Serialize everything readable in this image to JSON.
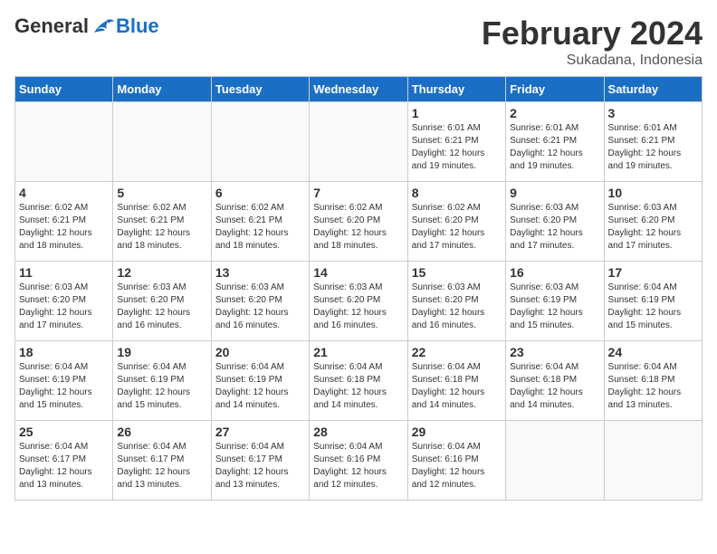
{
  "header": {
    "logo": {
      "general": "General",
      "blue": "Blue",
      "tagline": ""
    },
    "title": "February 2024",
    "subtitle": "Sukadana, Indonesia"
  },
  "weekdays": [
    "Sunday",
    "Monday",
    "Tuesday",
    "Wednesday",
    "Thursday",
    "Friday",
    "Saturday"
  ],
  "weeks": [
    [
      {
        "day": "",
        "info": ""
      },
      {
        "day": "",
        "info": ""
      },
      {
        "day": "",
        "info": ""
      },
      {
        "day": "",
        "info": ""
      },
      {
        "day": "1",
        "info": "Sunrise: 6:01 AM\nSunset: 6:21 PM\nDaylight: 12 hours\nand 19 minutes."
      },
      {
        "day": "2",
        "info": "Sunrise: 6:01 AM\nSunset: 6:21 PM\nDaylight: 12 hours\nand 19 minutes."
      },
      {
        "day": "3",
        "info": "Sunrise: 6:01 AM\nSunset: 6:21 PM\nDaylight: 12 hours\nand 19 minutes."
      }
    ],
    [
      {
        "day": "4",
        "info": "Sunrise: 6:02 AM\nSunset: 6:21 PM\nDaylight: 12 hours\nand 18 minutes."
      },
      {
        "day": "5",
        "info": "Sunrise: 6:02 AM\nSunset: 6:21 PM\nDaylight: 12 hours\nand 18 minutes."
      },
      {
        "day": "6",
        "info": "Sunrise: 6:02 AM\nSunset: 6:21 PM\nDaylight: 12 hours\nand 18 minutes."
      },
      {
        "day": "7",
        "info": "Sunrise: 6:02 AM\nSunset: 6:20 PM\nDaylight: 12 hours\nand 18 minutes."
      },
      {
        "day": "8",
        "info": "Sunrise: 6:02 AM\nSunset: 6:20 PM\nDaylight: 12 hours\nand 17 minutes."
      },
      {
        "day": "9",
        "info": "Sunrise: 6:03 AM\nSunset: 6:20 PM\nDaylight: 12 hours\nand 17 minutes."
      },
      {
        "day": "10",
        "info": "Sunrise: 6:03 AM\nSunset: 6:20 PM\nDaylight: 12 hours\nand 17 minutes."
      }
    ],
    [
      {
        "day": "11",
        "info": "Sunrise: 6:03 AM\nSunset: 6:20 PM\nDaylight: 12 hours\nand 17 minutes."
      },
      {
        "day": "12",
        "info": "Sunrise: 6:03 AM\nSunset: 6:20 PM\nDaylight: 12 hours\nand 16 minutes."
      },
      {
        "day": "13",
        "info": "Sunrise: 6:03 AM\nSunset: 6:20 PM\nDaylight: 12 hours\nand 16 minutes."
      },
      {
        "day": "14",
        "info": "Sunrise: 6:03 AM\nSunset: 6:20 PM\nDaylight: 12 hours\nand 16 minutes."
      },
      {
        "day": "15",
        "info": "Sunrise: 6:03 AM\nSunset: 6:20 PM\nDaylight: 12 hours\nand 16 minutes."
      },
      {
        "day": "16",
        "info": "Sunrise: 6:03 AM\nSunset: 6:19 PM\nDaylight: 12 hours\nand 15 minutes."
      },
      {
        "day": "17",
        "info": "Sunrise: 6:04 AM\nSunset: 6:19 PM\nDaylight: 12 hours\nand 15 minutes."
      }
    ],
    [
      {
        "day": "18",
        "info": "Sunrise: 6:04 AM\nSunset: 6:19 PM\nDaylight: 12 hours\nand 15 minutes."
      },
      {
        "day": "19",
        "info": "Sunrise: 6:04 AM\nSunset: 6:19 PM\nDaylight: 12 hours\nand 15 minutes."
      },
      {
        "day": "20",
        "info": "Sunrise: 6:04 AM\nSunset: 6:19 PM\nDaylight: 12 hours\nand 14 minutes."
      },
      {
        "day": "21",
        "info": "Sunrise: 6:04 AM\nSunset: 6:18 PM\nDaylight: 12 hours\nand 14 minutes."
      },
      {
        "day": "22",
        "info": "Sunrise: 6:04 AM\nSunset: 6:18 PM\nDaylight: 12 hours\nand 14 minutes."
      },
      {
        "day": "23",
        "info": "Sunrise: 6:04 AM\nSunset: 6:18 PM\nDaylight: 12 hours\nand 14 minutes."
      },
      {
        "day": "24",
        "info": "Sunrise: 6:04 AM\nSunset: 6:18 PM\nDaylight: 12 hours\nand 13 minutes."
      }
    ],
    [
      {
        "day": "25",
        "info": "Sunrise: 6:04 AM\nSunset: 6:17 PM\nDaylight: 12 hours\nand 13 minutes."
      },
      {
        "day": "26",
        "info": "Sunrise: 6:04 AM\nSunset: 6:17 PM\nDaylight: 12 hours\nand 13 minutes."
      },
      {
        "day": "27",
        "info": "Sunrise: 6:04 AM\nSunset: 6:17 PM\nDaylight: 12 hours\nand 13 minutes."
      },
      {
        "day": "28",
        "info": "Sunrise: 6:04 AM\nSunset: 6:16 PM\nDaylight: 12 hours\nand 12 minutes."
      },
      {
        "day": "29",
        "info": "Sunrise: 6:04 AM\nSunset: 6:16 PM\nDaylight: 12 hours\nand 12 minutes."
      },
      {
        "day": "",
        "info": ""
      },
      {
        "day": "",
        "info": ""
      }
    ]
  ]
}
